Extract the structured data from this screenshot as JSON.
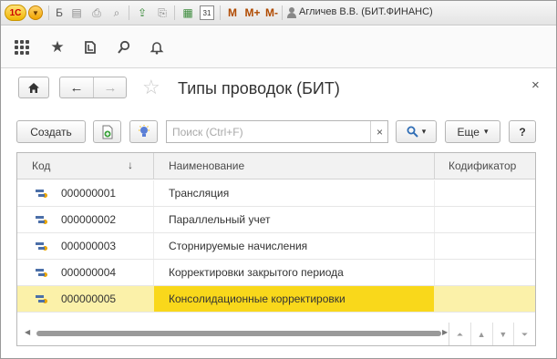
{
  "titlebar": {
    "letter_b": "Б",
    "m_label": "M",
    "m_plus_label": "M+",
    "m_minus_label": "M-",
    "user": "Агличев В.В. (БИТ.ФИНАНС)",
    "logo_text": "1С",
    "calendar_day": "31"
  },
  "appbar": {
    "icons": [
      "apps-grid-icon",
      "favorites-star-icon",
      "history-icon",
      "search-icon",
      "bell-icon"
    ]
  },
  "form": {
    "title": "Типы проводок (БИТ)",
    "home_glyph": "⌂",
    "back_glyph": "←",
    "forward_glyph": "→",
    "star_glyph": "☆",
    "close_glyph": "×"
  },
  "toolbar": {
    "create_label": "Создать",
    "search_placeholder": "Поиск (Ctrl+F)",
    "clear_glyph": "×",
    "more_label": "Еще",
    "more_arrow": "▾",
    "search_arrow": "▾",
    "help_label": "?"
  },
  "table": {
    "columns": [
      "Код",
      "Наименование",
      "Кодификатор"
    ],
    "sort_glyph": "↓",
    "rows": [
      {
        "code": "000000001",
        "name": "Трансляция",
        "codifier": ""
      },
      {
        "code": "000000002",
        "name": "Параллельный учет",
        "codifier": ""
      },
      {
        "code": "000000003",
        "name": "Сторнируемые начисления",
        "codifier": ""
      },
      {
        "code": "000000004",
        "name": "Корректировки закрытого периода",
        "codifier": ""
      },
      {
        "code": "000000005",
        "name": "Консолидационные корректировки",
        "codifier": ""
      }
    ],
    "selected_index": 4,
    "pager": [
      "⏶",
      "▲",
      "▼",
      "⏷"
    ]
  },
  "colors": {
    "selected_row": "#fbf1a9",
    "selected_cell": "#f9d81b",
    "accent_blue": "#4b6fa8"
  }
}
